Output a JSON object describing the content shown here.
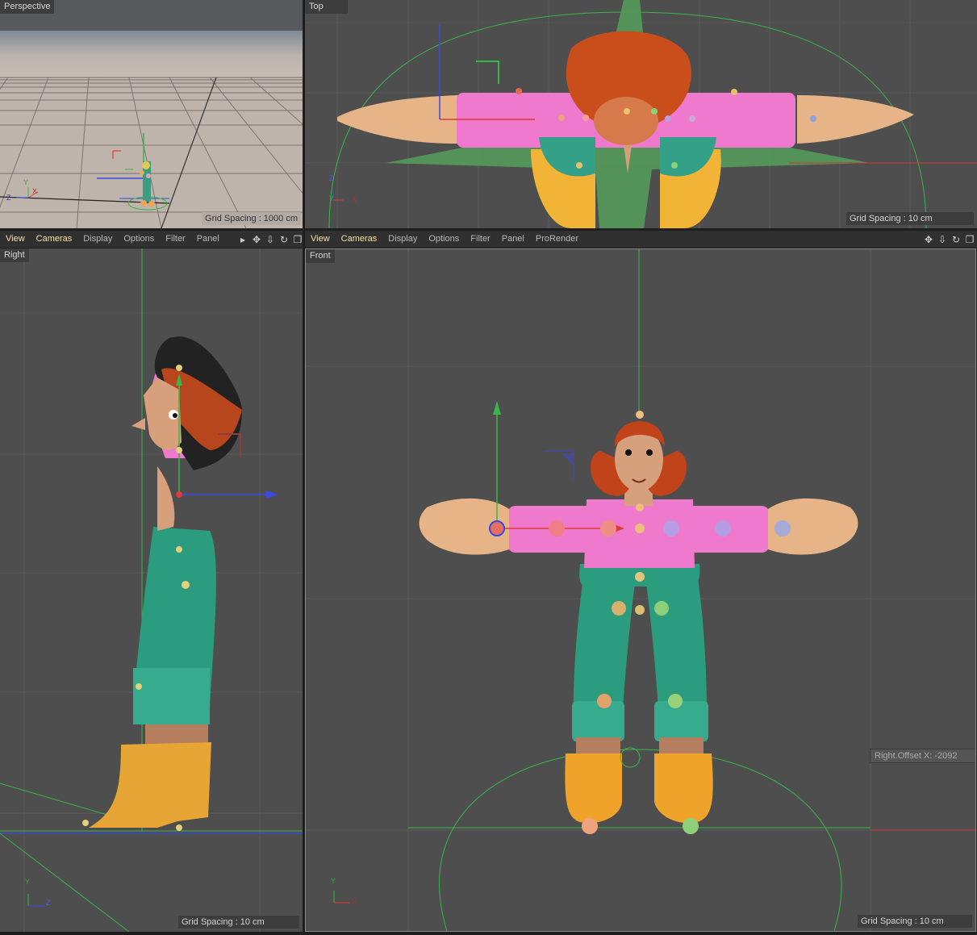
{
  "viewports": {
    "perspective": {
      "title": "Perspective",
      "grid_spacing": "Grid Spacing : 1000 cm"
    },
    "top": {
      "title": "Top",
      "grid_spacing": "Grid Spacing : 10 cm"
    },
    "right": {
      "title": "Right",
      "grid_spacing": "Grid Spacing : 10 cm"
    },
    "front": {
      "title": "Front",
      "grid_spacing": "Grid Spacing : 10 cm",
      "offset_readout": "Right.Offset X:   -2092"
    }
  },
  "menubar_left": {
    "items": [
      "View",
      "Cameras",
      "Display",
      "Options",
      "Filter",
      "Panel"
    ]
  },
  "menubar_right": {
    "items": [
      "View",
      "Cameras",
      "Display",
      "Options",
      "Filter",
      "Panel",
      "ProRender"
    ]
  },
  "axis_labels": {
    "x": "X",
    "y": "Y",
    "z": "Z"
  },
  "icons": [
    "move-view-icon",
    "dolly-view-icon",
    "rotate-view-icon",
    "maximize-view-icon",
    "more-arrow-icon"
  ],
  "colors": {
    "viewport_bg": "#4e4e4e",
    "menu_bg": "#303030",
    "active_menu": "#f3e59a",
    "x_axis": "#e03a3a",
    "y_axis": "#3ab54a",
    "z_axis": "#3a4ae0"
  }
}
